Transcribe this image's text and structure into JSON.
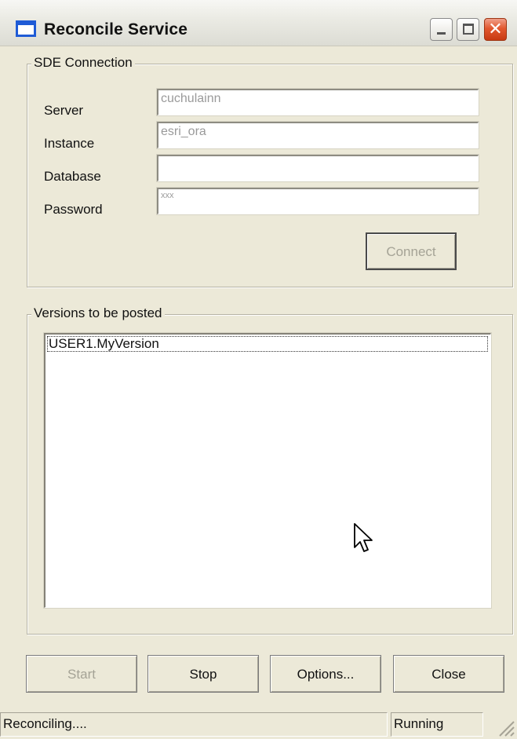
{
  "window": {
    "title": "Reconcile Service",
    "buttons": {
      "minimize_icon": "minimize-icon",
      "maximize_icon": "maximize-icon",
      "close_icon": "close-icon",
      "close_glyph": "✕"
    }
  },
  "sde_connection": {
    "group_label": "SDE Connection",
    "fields": {
      "server": {
        "label": "Server",
        "value": "cuchulainn"
      },
      "instance": {
        "label": "Instance",
        "value": "esri_ora"
      },
      "database": {
        "label": "Database",
        "value": ""
      },
      "password": {
        "label": "Password",
        "value": "xxx"
      }
    },
    "connect_button": {
      "label": "Connect",
      "enabled": false
    }
  },
  "versions": {
    "group_label": "Versions to be posted",
    "items": [
      "USER1.MyVersion"
    ]
  },
  "buttons": {
    "start": {
      "label": "Start",
      "enabled": false
    },
    "stop": {
      "label": "Stop",
      "enabled": true
    },
    "options": {
      "label": "Options...",
      "enabled": true
    },
    "close": {
      "label": "Close",
      "enabled": true
    }
  },
  "statusbar": {
    "message": "Reconciling....",
    "state": "Running"
  },
  "colors": {
    "titlebar_accent": "#1f5bd6",
    "close_button": "#e2582f",
    "dialog_background": "#ece9d8",
    "disabled_text": "#a5a396"
  }
}
